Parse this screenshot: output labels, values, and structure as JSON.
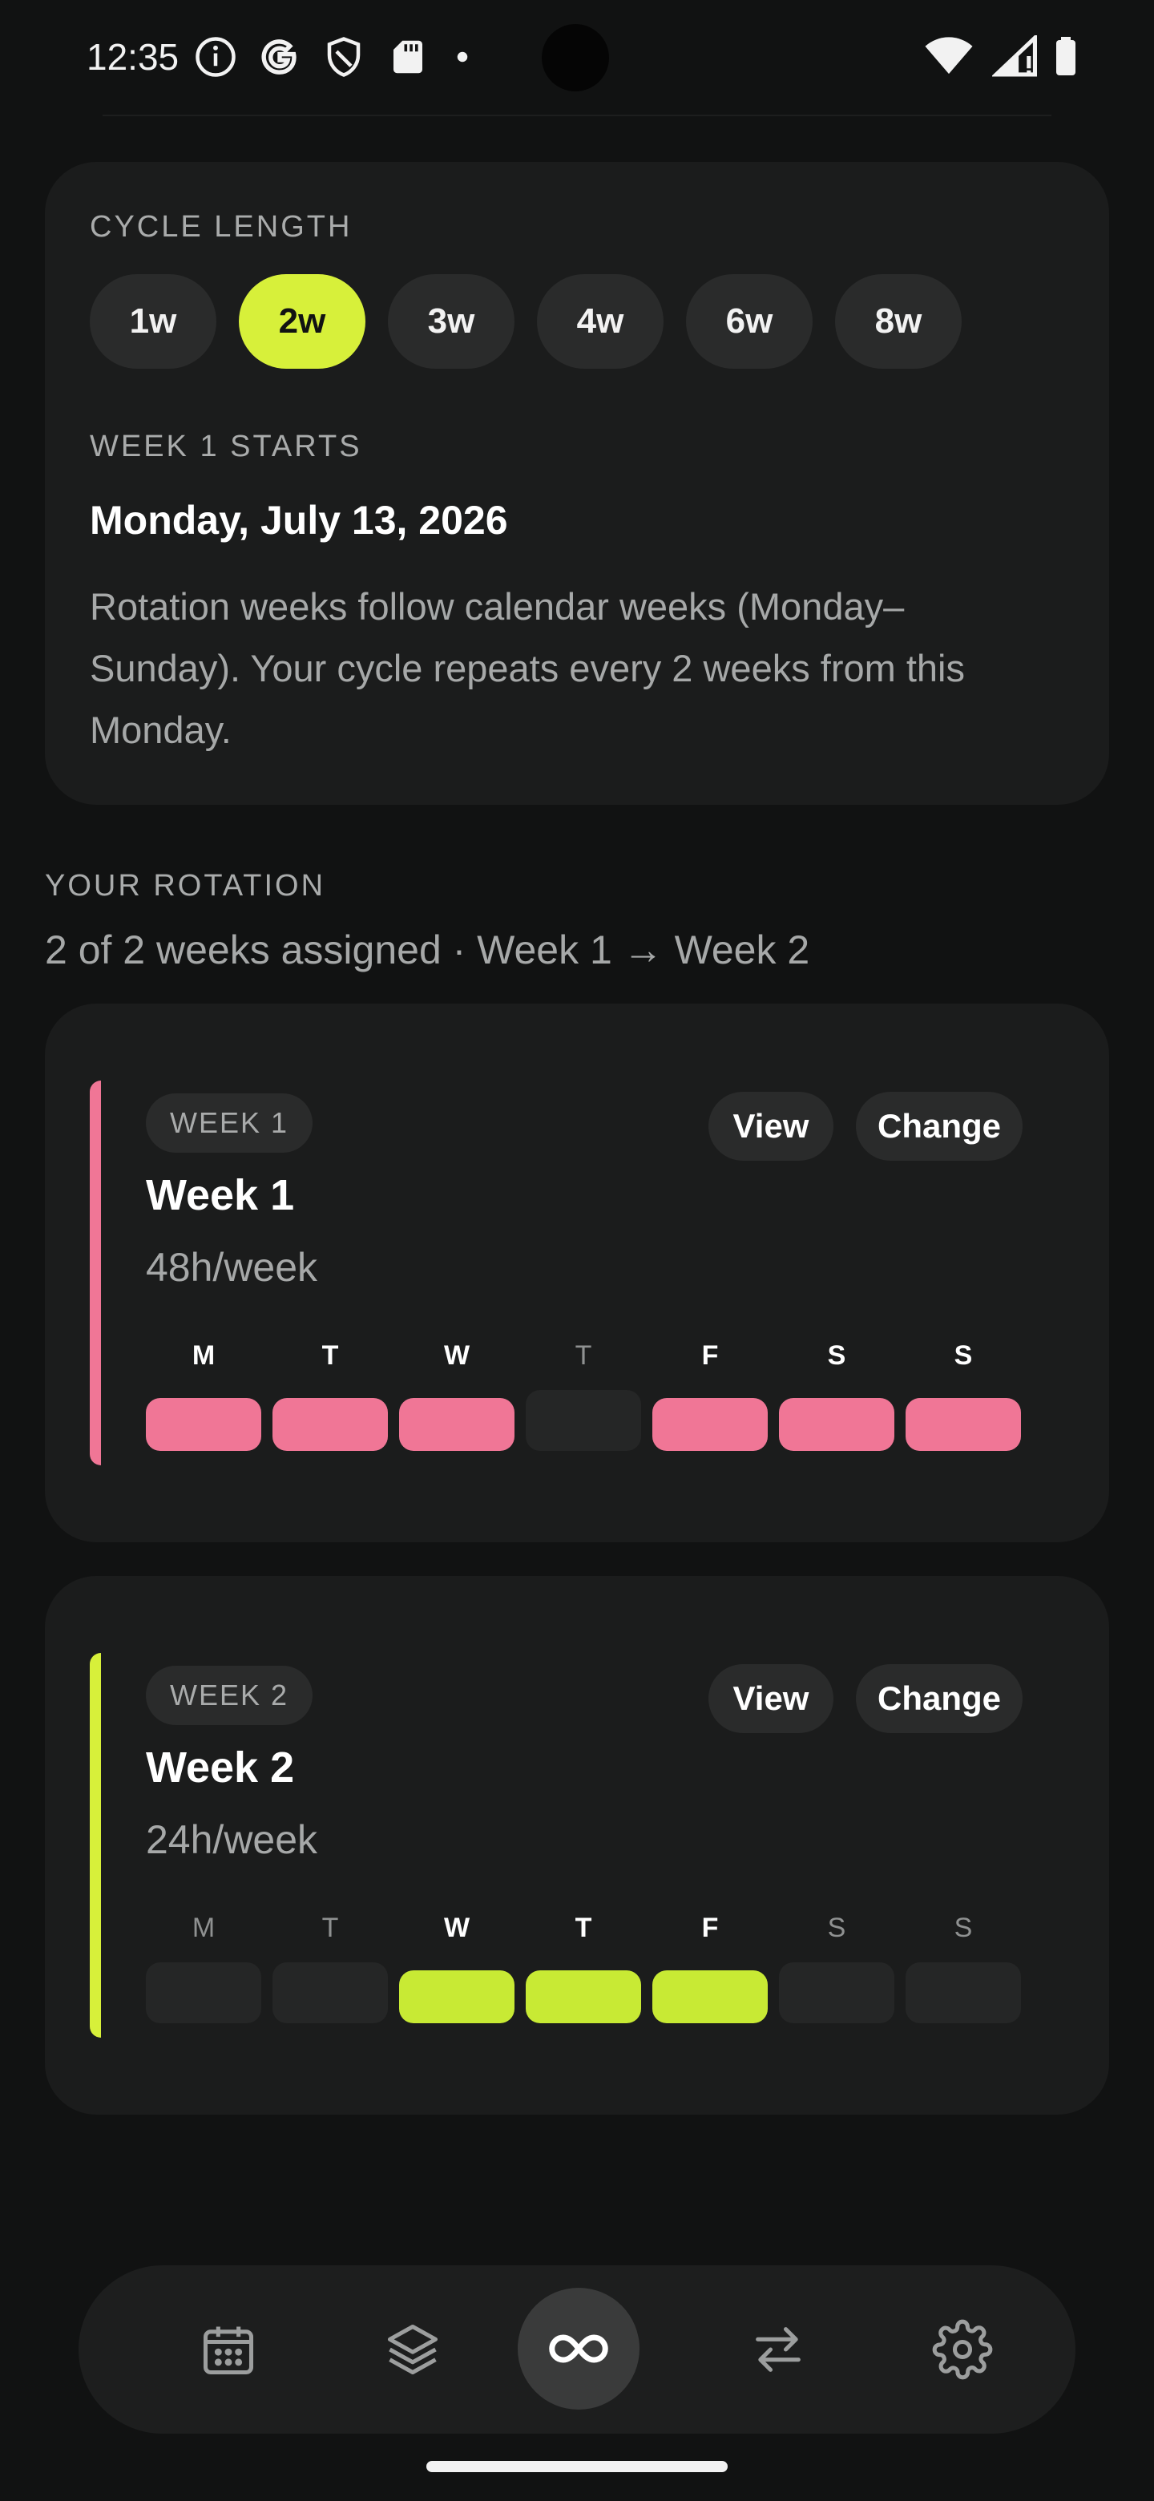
{
  "status_bar": {
    "time": "12:35",
    "left_icons": [
      "info-icon",
      "google-icon",
      "shield-icon",
      "sd-card-icon",
      "dot-icon"
    ],
    "right_icons": [
      "wifi-icon",
      "signal-icon",
      "battery-icon"
    ]
  },
  "cycle": {
    "label": "CYCLE LENGTH",
    "options": [
      "1w",
      "2w",
      "3w",
      "4w",
      "6w",
      "8w"
    ],
    "selected": "2w",
    "start_label": "WEEK 1 STARTS",
    "start_date": "Monday, July 13, 2026",
    "note": "Rotation weeks follow calendar weeks (Monday–Sunday). Your cycle repeats every 2 weeks from this Monday."
  },
  "rotation": {
    "label": "YOUR ROTATION",
    "summary": "2 of 2 weeks assigned · Week 1 → Week 2",
    "weeks": [
      {
        "badge": "WEEK 1",
        "title": "Week 1",
        "hours": "48h/week",
        "view_label": "View",
        "change_label": "Change",
        "accent": "#f07696",
        "days": [
          {
            "letter": "M",
            "on": true
          },
          {
            "letter": "T",
            "on": true
          },
          {
            "letter": "W",
            "on": true
          },
          {
            "letter": "T",
            "on": false
          },
          {
            "letter": "F",
            "on": true
          },
          {
            "letter": "S",
            "on": true
          },
          {
            "letter": "S",
            "on": true
          }
        ]
      },
      {
        "badge": "WEEK 2",
        "title": "Week 2",
        "hours": "24h/week",
        "view_label": "View",
        "change_label": "Change",
        "accent": "#d7f03a",
        "days": [
          {
            "letter": "M",
            "on": false
          },
          {
            "letter": "T",
            "on": false
          },
          {
            "letter": "W",
            "on": true
          },
          {
            "letter": "T",
            "on": true
          },
          {
            "letter": "F",
            "on": true
          },
          {
            "letter": "S",
            "on": false
          },
          {
            "letter": "S",
            "on": false
          }
        ]
      }
    ]
  },
  "nav": {
    "items": [
      "calendar-icon",
      "layers-icon",
      "infinity-icon",
      "swap-icon",
      "settings-icon"
    ],
    "active": "infinity-icon"
  },
  "colors": {
    "background": "#111212",
    "card": "#1b1c1c",
    "accent_lime": "#d7f03a",
    "accent_pink": "#f07696"
  }
}
